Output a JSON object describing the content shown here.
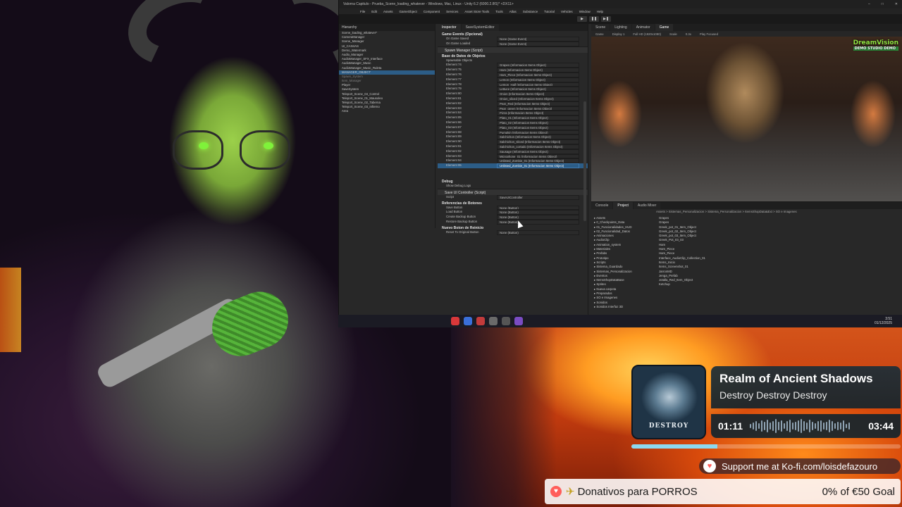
{
  "unity": {
    "title": "Valorna Capitulo - Prueba_Scene_loading_whatever - Windows, Mac, Linux - Unity 6.2 (6000.2.8f1)* <DX11>",
    "menu": [
      "File",
      "Edit",
      "Assets",
      "GameObject",
      "Component",
      "Services",
      "Asset Store Tools",
      "Tools",
      "Atlas",
      "Substance",
      "Tutorial",
      "Vehicles",
      "Window",
      "Help"
    ],
    "hierarchy": {
      "tab": "Hierarchy",
      "rows": [
        {
          "label": "Scene_loading_whatever*",
          "sel": false,
          "dim": false
        },
        {
          "label": "CameraManager",
          "sel": false,
          "dim": false
        },
        {
          "label": "Scene_Manager",
          "sel": false,
          "dim": false
        },
        {
          "label": "UI_CANVAS",
          "sel": false,
          "dim": false
        },
        {
          "label": "Demo_Watermark",
          "sel": false,
          "dim": false
        },
        {
          "label": "Audio_Manager",
          "sel": false,
          "dim": false
        },
        {
          "label": "AudioManager_SFX_Interface",
          "sel": false,
          "dim": false
        },
        {
          "label": "AudioManager_Music",
          "sel": false,
          "dim": false
        },
        {
          "label": "AudioManager_Music_Ruleta",
          "sel": false,
          "dim": false
        },
        {
          "label": "MANAGER_OBJECT",
          "sel": true,
          "dim": false
        },
        {
          "label": "Spawn_System",
          "sel": false,
          "dim": true
        },
        {
          "label": "Item_Manager",
          "sel": false,
          "dim": true
        },
        {
          "label": "Player",
          "sel": false,
          "dim": false
        },
        {
          "label": "SaveSystem",
          "sel": false,
          "dim": false
        },
        {
          "label": "Teleport_Scene_04_Control",
          "sel": false,
          "dim": false
        },
        {
          "label": "Teleport_Scene_01_Mausoleo",
          "sel": false,
          "dim": false
        },
        {
          "label": "Teleport_Scene_02_Taberna",
          "sel": false,
          "dim": false
        },
        {
          "label": "Teleport_Scene_03_Infierno",
          "sel": false,
          "dim": false
        },
        {
          "label": "Area",
          "sel": false,
          "dim": false
        }
      ]
    },
    "inspector": {
      "tabs": [
        "Inspector",
        "SaveSystemEditor"
      ],
      "events_header": "Game Events (Opcional)",
      "events": [
        {
          "k": "On Game Saved",
          "v": "None (Game Event)"
        },
        {
          "k": "On Game Loaded",
          "v": "None (Game Event)"
        }
      ],
      "component1": "Spawn Manager (Script)",
      "db_header": "Base de Datos de Objetos",
      "list_label": "Spawnable Objects",
      "elements": [
        {
          "k": "Element 74",
          "v": "Grapes (Informacion Items Object)"
        },
        {
          "k": "Element 75",
          "v": "Ham (Informacion Items Object)"
        },
        {
          "k": "Element 76",
          "v": "Ham_Piece (Informacion Items Object)"
        },
        {
          "k": "Element 77",
          "v": "Lemon (Informacion Items Object)"
        },
        {
          "k": "Element 78",
          "v": "Lemon_Half (Informacion Items Object)"
        },
        {
          "k": "Element 79",
          "v": "Lettuce (Informacion Items Object)"
        },
        {
          "k": "Element 80",
          "v": "Onion (Informacion Items Object)"
        },
        {
          "k": "Element 81",
          "v": "Onion_sliced (Informacion Items Object)"
        },
        {
          "k": "Element 82",
          "v": "Pear_Red (Informacion Items Object)"
        },
        {
          "k": "Element 83",
          "v": "Pear_green (Informacion Items Object)"
        },
        {
          "k": "Element 84",
          "v": "Pizza (Informacion Items Object)"
        },
        {
          "k": "Element 85",
          "v": "Plato_01 (Informacion Items Object)"
        },
        {
          "k": "Element 86",
          "v": "Plato_02 (Informacion Items Object)"
        },
        {
          "k": "Element 87",
          "v": "Plato_03 (Informacion Items Object)"
        },
        {
          "k": "Element 88",
          "v": "Pumpkin (Informacion Items Object)"
        },
        {
          "k": "Element 89",
          "v": "Salchichon (Informacion Items Object)"
        },
        {
          "k": "Element 90",
          "v": "Salchichon_sliced (Informacion Items Object)"
        },
        {
          "k": "Element 91",
          "v": "Salchichon_cortado (Informacion Items Object)"
        },
        {
          "k": "Element 92",
          "v": "Sausage (Informacion Items Object)"
        },
        {
          "k": "Element 93",
          "v": "Microphone_01 (Informacion Items Object)"
        },
        {
          "k": "Element 94",
          "v": "Unlisted_Zombie_01 (Informacion Items Object)"
        },
        {
          "k": "Element 95",
          "v": "Unlisted_Zombie_01 (Informacion Items Object)"
        }
      ],
      "debug_header": "Debug",
      "debug_field": "Show Debug Logs",
      "component2": "Save UI Controller (Script)",
      "script_field": "SaveUIController",
      "buttons_header": "Referencias de Botones",
      "buttons": [
        {
          "k": "Save Button",
          "v": "None (Button)"
        },
        {
          "k": "Load Button",
          "v": "None (Button)"
        },
        {
          "k": "Create Backup Button",
          "v": "None (Button)"
        },
        {
          "k": "Restore Backup Button",
          "v": "None (Button)"
        }
      ],
      "reset_header": "Nuevo Boton de Reinicio",
      "reset_field": {
        "k": "Reset To Original Button",
        "v": "None (Button)"
      }
    },
    "game": {
      "tabs": [
        "Scene",
        "Lighting",
        "Animator",
        "Game"
      ],
      "bar": [
        "Game",
        "Display 1",
        "Full HD (1920x1080)",
        "Scale",
        "0.3x",
        "Play Focused"
      ],
      "logo": "DreamVision",
      "logo_sub": "DEMO STUDIO DEMO"
    },
    "project": {
      "tabs": [
        "Console",
        "Project",
        "Audio Mixer"
      ],
      "breadcrumb": "Assets > Sistemas_Personalizacion > Sistema_Personalizacion > ItemsShopData&Ext > SO e Imagenes",
      "tree": [
        "Assets",
        "0_Checkpoints_Data",
        "01_Funcionalidades_HUD",
        "02_Funcionalidad_Datos",
        "Animaciones",
        "AudioClip",
        "Animation_system",
        "Materiales",
        "Prefabs",
        "Prototipo",
        "Scripts",
        "Sistema_Guardado",
        "Sistemas_Personalizacion",
        "Eventos",
        "ItemsShopDataBase",
        "Sprites",
        "Nueva carpeta",
        "Preparados",
        "SO e Imagenes",
        "Sonidos",
        "Sonidos Interfaz 3D"
      ],
      "files": [
        "Grapes",
        "Grapes",
        "Greek_pot_01_Item_Object",
        "Greek_pot_02_Item_Object",
        "Greek_pot_03_Item_Object",
        "Greek_Pot_03_03",
        "Ham",
        "Ham_Piece",
        "Ham_Piece",
        "Interface_AudioClip_Collection_01",
        "Items_Inicio",
        "Items_Screenshot_01",
        "JarronMD",
        "Jenga_Prefab",
        "Jotalla_Red_Item_Object",
        "Ketchup"
      ]
    },
    "clock": {
      "time": "3:51",
      "date": "01/12/2025"
    }
  },
  "music": {
    "song": "Realm of Ancient Shadows",
    "artist": "Destroy Destroy Destroy",
    "elapsed": "01:11",
    "total": "03:44",
    "progress": 0.32,
    "art_text": "DESTROY",
    "accent": "#8dd9f0"
  },
  "kofi": {
    "label": "Support me at Ko-fi.com/loisdefazouro",
    "icon": "ko-fi-heart-icon"
  },
  "donation": {
    "label": "Donativos para PORROS",
    "goal": "0% of €50 Goal",
    "icon": "heart-icon"
  }
}
